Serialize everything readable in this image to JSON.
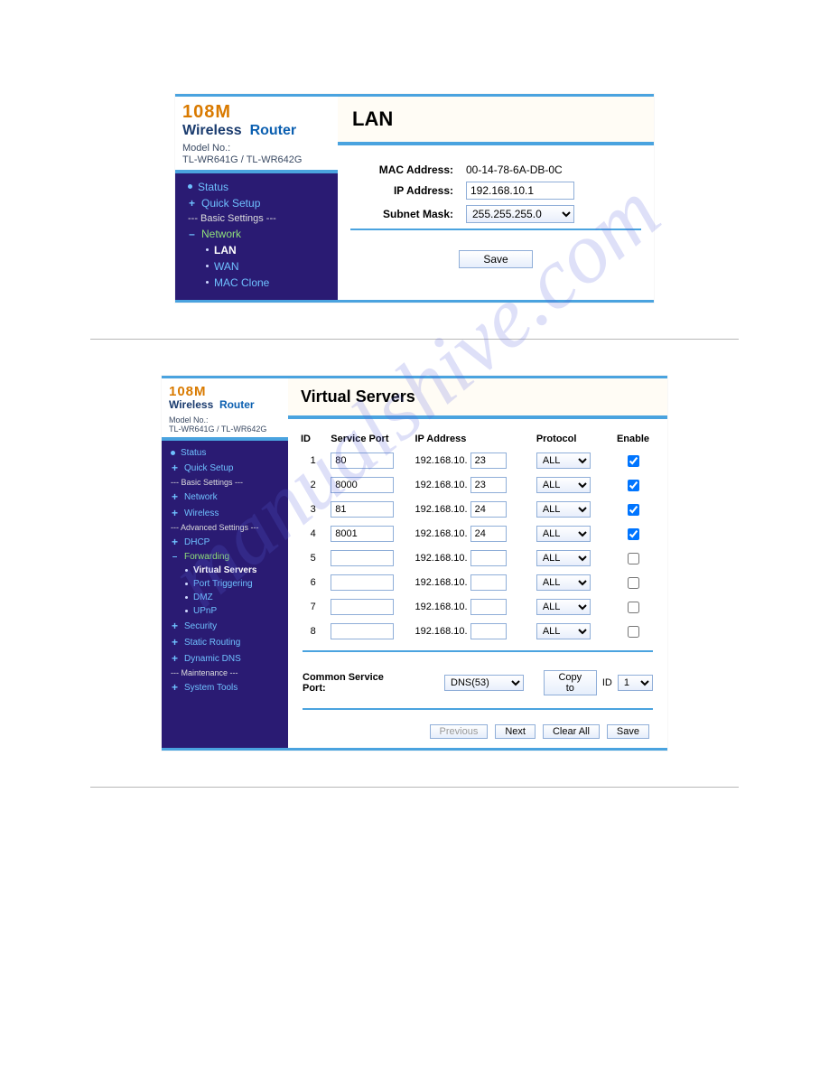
{
  "watermark": "manualshive.com",
  "header": {
    "brand1": "108M",
    "brand2a": "Wireless",
    "brand2b": "Router",
    "model_label": "Model No.:",
    "model_value": "TL-WR641G / TL-WR642G"
  },
  "fig1": {
    "title": "LAN",
    "nav": {
      "status": "Status",
      "quick_setup": "Quick Setup",
      "basic_settings": "--- Basic Settings ---",
      "network": "Network",
      "lan": "LAN",
      "wan": "WAN",
      "mac_clone": "MAC Clone"
    },
    "form": {
      "mac_label": "MAC Address:",
      "mac_value": "00-14-78-6A-DB-0C",
      "ip_label": "IP Address:",
      "ip_value": "192.168.10.1",
      "subnet_label": "Subnet Mask:",
      "subnet_value": "255.255.255.0",
      "save": "Save"
    }
  },
  "fig2": {
    "title": "Virtual Servers",
    "nav": {
      "status": "Status",
      "quick_setup": "Quick Setup",
      "basic_settings": "--- Basic Settings ---",
      "network": "Network",
      "wireless": "Wireless",
      "advanced_settings": "--- Advanced Settings ---",
      "dhcp": "DHCP",
      "forwarding": "Forwarding",
      "virtual_servers": "Virtual Servers",
      "port_triggering": "Port Triggering",
      "dmz": "DMZ",
      "upnp": "UPnP",
      "security": "Security",
      "static_routing": "Static Routing",
      "dynamic_dns": "Dynamic DNS",
      "maintenance": "--- Maintenance ---",
      "system_tools": "System Tools"
    },
    "columns": {
      "id": "ID",
      "service_port": "Service Port",
      "ip_address": "IP Address",
      "protocol": "Protocol",
      "enable": "Enable"
    },
    "ip_prefix": "192.168.10.",
    "rows": [
      {
        "id": "1",
        "port": "80",
        "ip": "23",
        "protocol": "ALL",
        "enable": true
      },
      {
        "id": "2",
        "port": "8000",
        "ip": "23",
        "protocol": "ALL",
        "enable": true
      },
      {
        "id": "3",
        "port": "81",
        "ip": "24",
        "protocol": "ALL",
        "enable": true
      },
      {
        "id": "4",
        "port": "8001",
        "ip": "24",
        "protocol": "ALL",
        "enable": true
      },
      {
        "id": "5",
        "port": "",
        "ip": "",
        "protocol": "ALL",
        "enable": false
      },
      {
        "id": "6",
        "port": "",
        "ip": "",
        "protocol": "ALL",
        "enable": false
      },
      {
        "id": "7",
        "port": "",
        "ip": "",
        "protocol": "ALL",
        "enable": false
      },
      {
        "id": "8",
        "port": "",
        "ip": "",
        "protocol": "ALL",
        "enable": false
      }
    ],
    "footer": {
      "csp_label": "Common Service Port:",
      "csp_value": "DNS(53)",
      "copy_to": "Copy to",
      "id_label": "ID",
      "id_value": "1",
      "previous": "Previous",
      "next": "Next",
      "clear_all": "Clear All",
      "save": "Save"
    }
  }
}
